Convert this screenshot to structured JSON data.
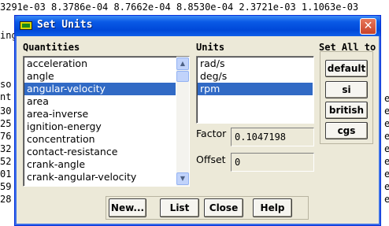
{
  "console": {
    "left_lines": [
      "3291e-03 8.3786e-04 8.7662e-04 8.8530e-04 2.3721e-03 1.1063e-03",
      "",
      "ing",
      "",
      "",
      "",
      "",
      "so",
      "nt",
      "30",
      "25",
      "76",
      "32",
      "52",
      "01",
      "59",
      "28"
    ],
    "right_lines": [
      "e",
      "e",
      "e",
      "e",
      "e",
      "e",
      "e",
      "e",
      "e"
    ]
  },
  "window": {
    "title": "Set Units",
    "close_glyph": "✕"
  },
  "quantities": {
    "label": "Quantities",
    "items": [
      "acceleration",
      "angle",
      "angular-velocity",
      "area",
      "area-inverse",
      "ignition-energy",
      "concentration",
      "contact-resistance",
      "crank-angle",
      "crank-angular-velocity"
    ],
    "selected_index": 2
  },
  "units": {
    "label": "Units",
    "items": [
      "rad/s",
      "deg/s",
      "rpm"
    ],
    "selected_index": 2
  },
  "factor": {
    "label": "Factor",
    "value": "0.1047198"
  },
  "offset": {
    "label": "Offset",
    "value": "0"
  },
  "set_all": {
    "label": "Set All to",
    "buttons": [
      "default",
      "si",
      "british",
      "cgs"
    ]
  },
  "actions": {
    "new_label": "New...",
    "list_label": "List",
    "close_label": "Close",
    "help_label": "Help"
  },
  "scroll_icons": {
    "up": "▲",
    "down": "▼"
  }
}
